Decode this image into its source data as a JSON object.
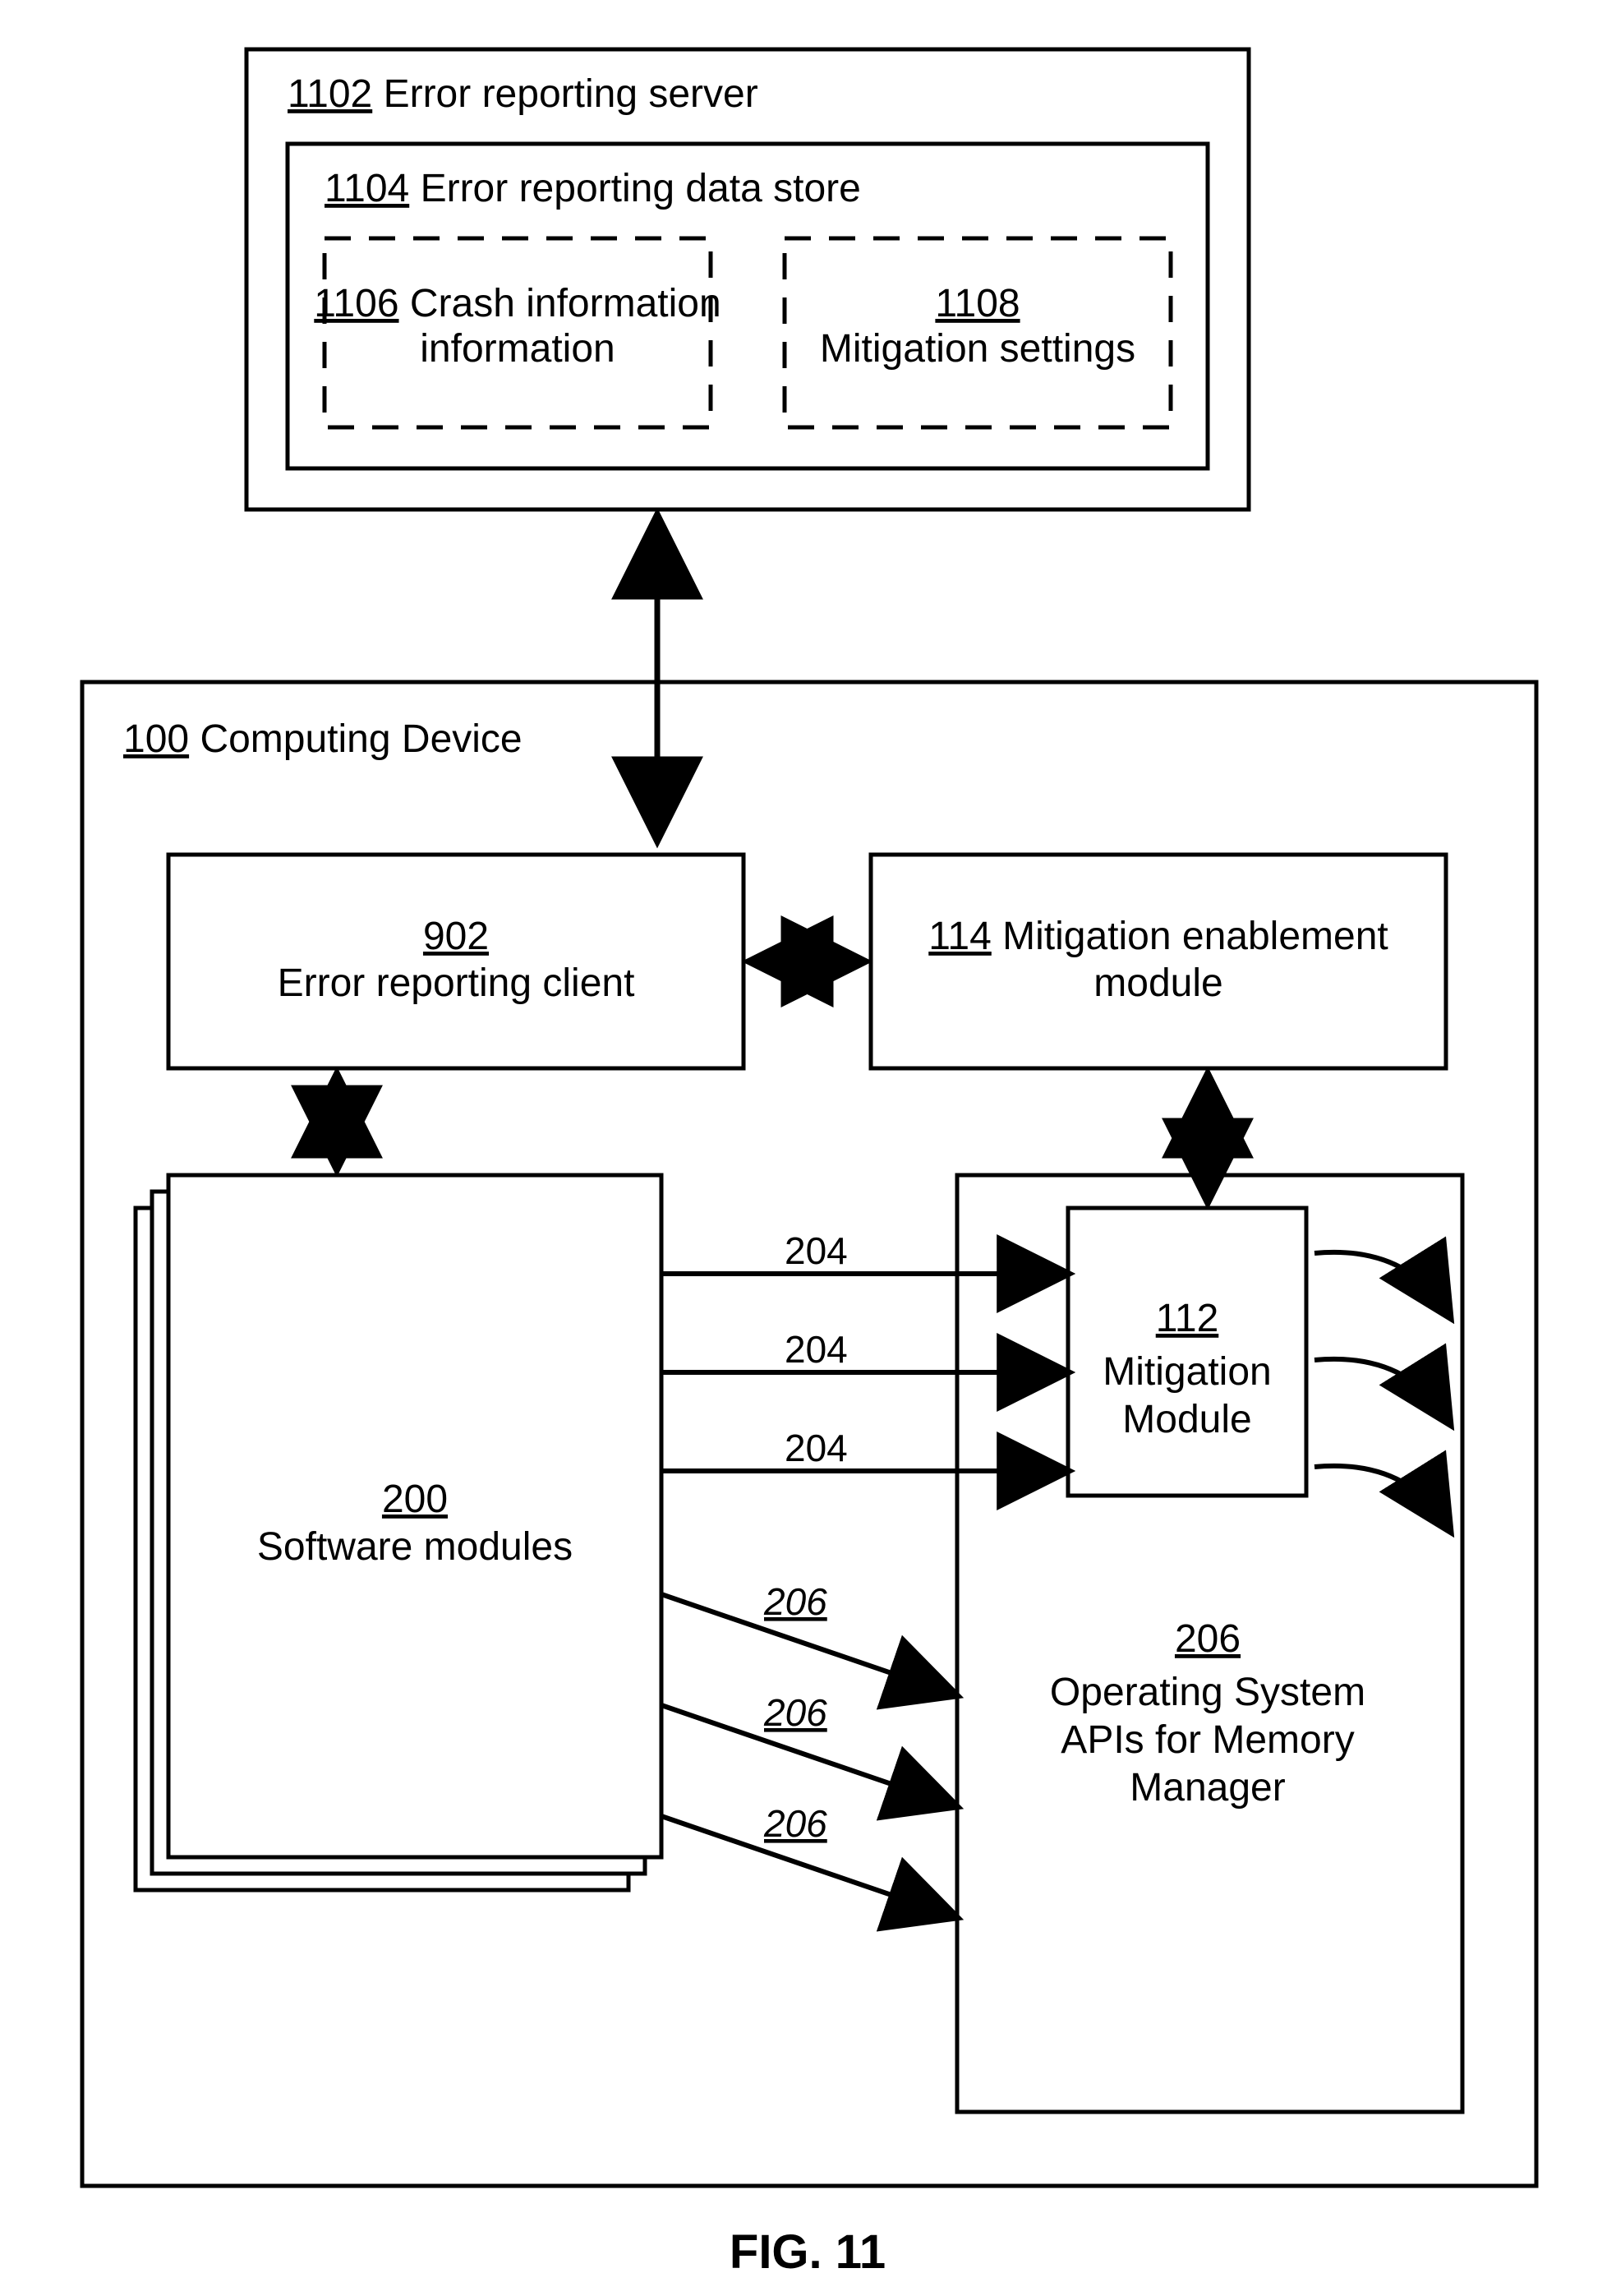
{
  "figure": {
    "ref": "FIG. 11"
  },
  "boxes": {
    "server": {
      "num": "1102",
      "label": "Error reporting server"
    },
    "datastore": {
      "num": "1104",
      "label": "Error reporting data store"
    },
    "crash": {
      "num": "1106",
      "label": "Crash information"
    },
    "mitigationset": {
      "num": "1108",
      "label": "Mitigation settings"
    },
    "device": {
      "num": "100",
      "label": "Computing Device"
    },
    "errclient": {
      "num": "902",
      "label": "Error reporting client"
    },
    "enablement": {
      "num": "114",
      "label": "Mitigation enablement module"
    },
    "swmodules": {
      "num": "200",
      "label": "Software modules"
    },
    "mitmodule": {
      "num": "112",
      "label": "Mitigation Module"
    },
    "osapis": {
      "num": "206",
      "label": "Operating System APIs for Memory Manager"
    }
  },
  "arrowLabels": {
    "a204": "204",
    "a206": "206"
  }
}
